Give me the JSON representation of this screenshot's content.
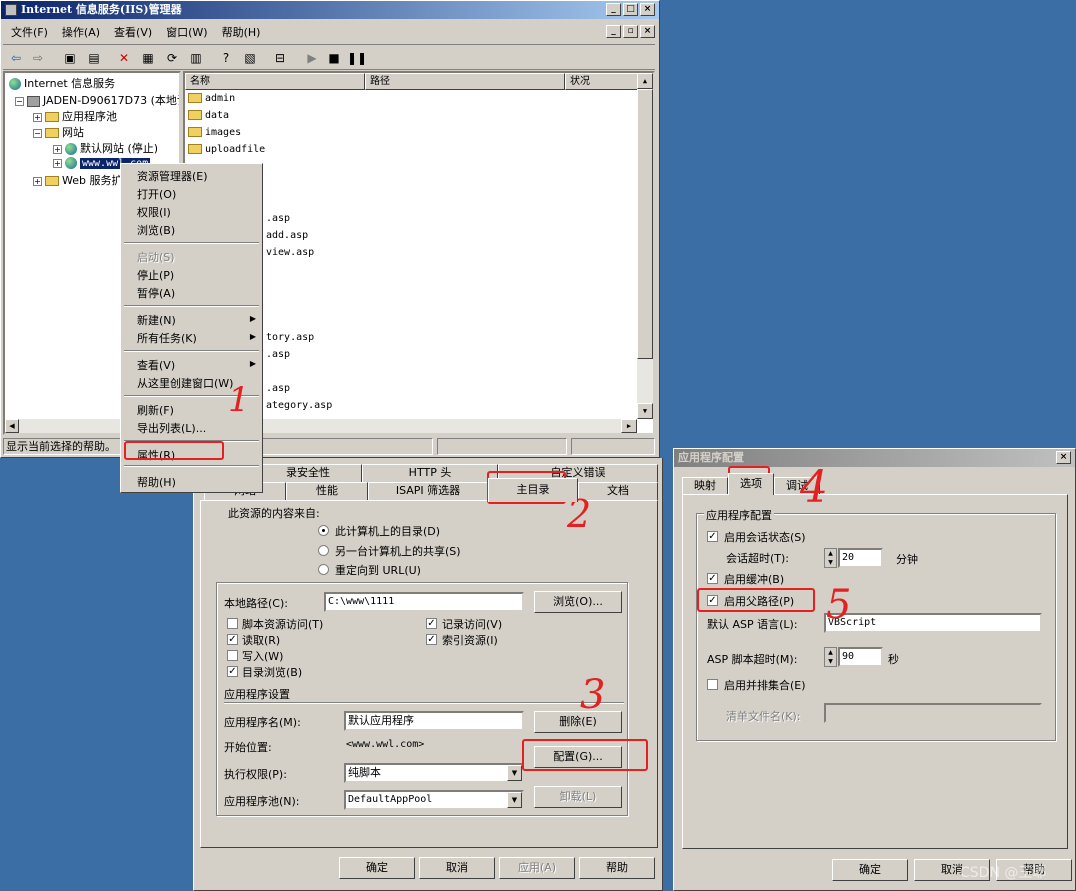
{
  "iis": {
    "title": "Internet 信息服务(IIS)管理器",
    "menu": [
      "文件(F)",
      "操作(A)",
      "查看(V)",
      "窗口(W)",
      "帮助(H)"
    ],
    "tree": {
      "root": "Internet 信息服务",
      "server": "JADEN-D90617D73 (本地计",
      "app_pools": "应用程序池",
      "websites": "网站",
      "default_site": "默认网站 (停止)",
      "site": "www.wwl.com",
      "web_ext": "Web 服务扩"
    },
    "list_headers": [
      "名称",
      "路径",
      "状况"
    ],
    "files": [
      "admin",
      "data",
      "images",
      "uploadfile"
    ],
    "files_partial": [
      ".asp",
      "add.asp",
      "view.asp",
      "tory.asp",
      ".asp",
      ".asp",
      "ategory.asp"
    ],
    "status_text": "显示当前选择的帮助。"
  },
  "context_menu": {
    "items": [
      {
        "label": "资源管理器(E)",
        "disabled": false
      },
      {
        "label": "打开(O)",
        "disabled": false
      },
      {
        "label": "权限(I)",
        "disabled": false
      },
      {
        "label": "浏览(B)",
        "disabled": false
      },
      {
        "label": "启动(S)",
        "disabled": true
      },
      {
        "label": "停止(P)",
        "disabled": false
      },
      {
        "label": "暂停(A)",
        "disabled": false
      },
      {
        "label": "新建(N)",
        "disabled": false
      },
      {
        "label": "所有任务(K)",
        "disabled": false
      },
      {
        "label": "查看(V)",
        "disabled": false
      },
      {
        "label": "从这里创建窗口(W)",
        "disabled": false
      },
      {
        "label": "刷新(F)",
        "disabled": false
      },
      {
        "label": "导出列表(L)...",
        "disabled": false
      },
      {
        "label": "属性(R)",
        "disabled": false
      },
      {
        "label": "帮助(H)",
        "disabled": false
      }
    ]
  },
  "props": {
    "tabs_back": [
      "录安全性",
      "HTTP 头",
      "自定义错误"
    ],
    "tabs_front": [
      "网站",
      "性能",
      "ISAPI 筛选器",
      "主目录",
      "文档"
    ],
    "source_label": "此资源的内容来自:",
    "radios": [
      "此计算机上的目录(D)",
      "另一台计算机上的共享(S)",
      "重定向到 URL(U)"
    ],
    "local_path_label": "本地路径(C):",
    "local_path": "C:\\www\\1111",
    "browse": "浏览(O)...",
    "checks_left": [
      {
        "label": "脚本资源访问(T)",
        "checked": false
      },
      {
        "label": "读取(R)",
        "checked": true
      },
      {
        "label": "写入(W)",
        "checked": false
      },
      {
        "label": "目录浏览(B)",
        "checked": true
      }
    ],
    "checks_right": [
      {
        "label": "记录访问(V)",
        "checked": true
      },
      {
        "label": "索引资源(I)",
        "checked": true
      }
    ],
    "app_settings": "应用程序设置",
    "app_name_label": "应用程序名(M):",
    "app_name": "默认应用程序",
    "remove": "删除(E)",
    "start_label": "开始位置:",
    "start_value": "<www.wwl.com>",
    "config": "配置(G)...",
    "exec_label": "执行权限(P):",
    "exec_value": "纯脚本",
    "pool_label": "应用程序池(N):",
    "pool_value": "DefaultAppPool",
    "unload": "卸载(L)",
    "ok": "确定",
    "cancel": "取消",
    "apply": "应用(A)",
    "help": "帮助"
  },
  "appconfig": {
    "title": "应用程序配置",
    "tabs": [
      "映射",
      "选项",
      "调试"
    ],
    "group": "应用程序配置",
    "session_state": "启用会话状态(S)",
    "session_timeout_label": "会话超时(T):",
    "session_timeout": "20",
    "minutes": "分钟",
    "buffering": "启用缓冲(B)",
    "parent_paths": "启用父路径(P)",
    "asp_lang_label": "默认 ASP 语言(L):",
    "asp_lang": "VBScript",
    "script_timeout_label": "ASP 脚本超时(M):",
    "script_timeout": "90",
    "seconds": "秒",
    "side_by_side": "启用并排集合(E)",
    "manifest_label": "清单文件名(K):",
    "ok": "确定",
    "cancel": "取消",
    "help": "帮助"
  },
  "annotations": [
    "1",
    "2",
    "3",
    "4",
    "5"
  ],
  "watermark": "CSDN @王耶"
}
